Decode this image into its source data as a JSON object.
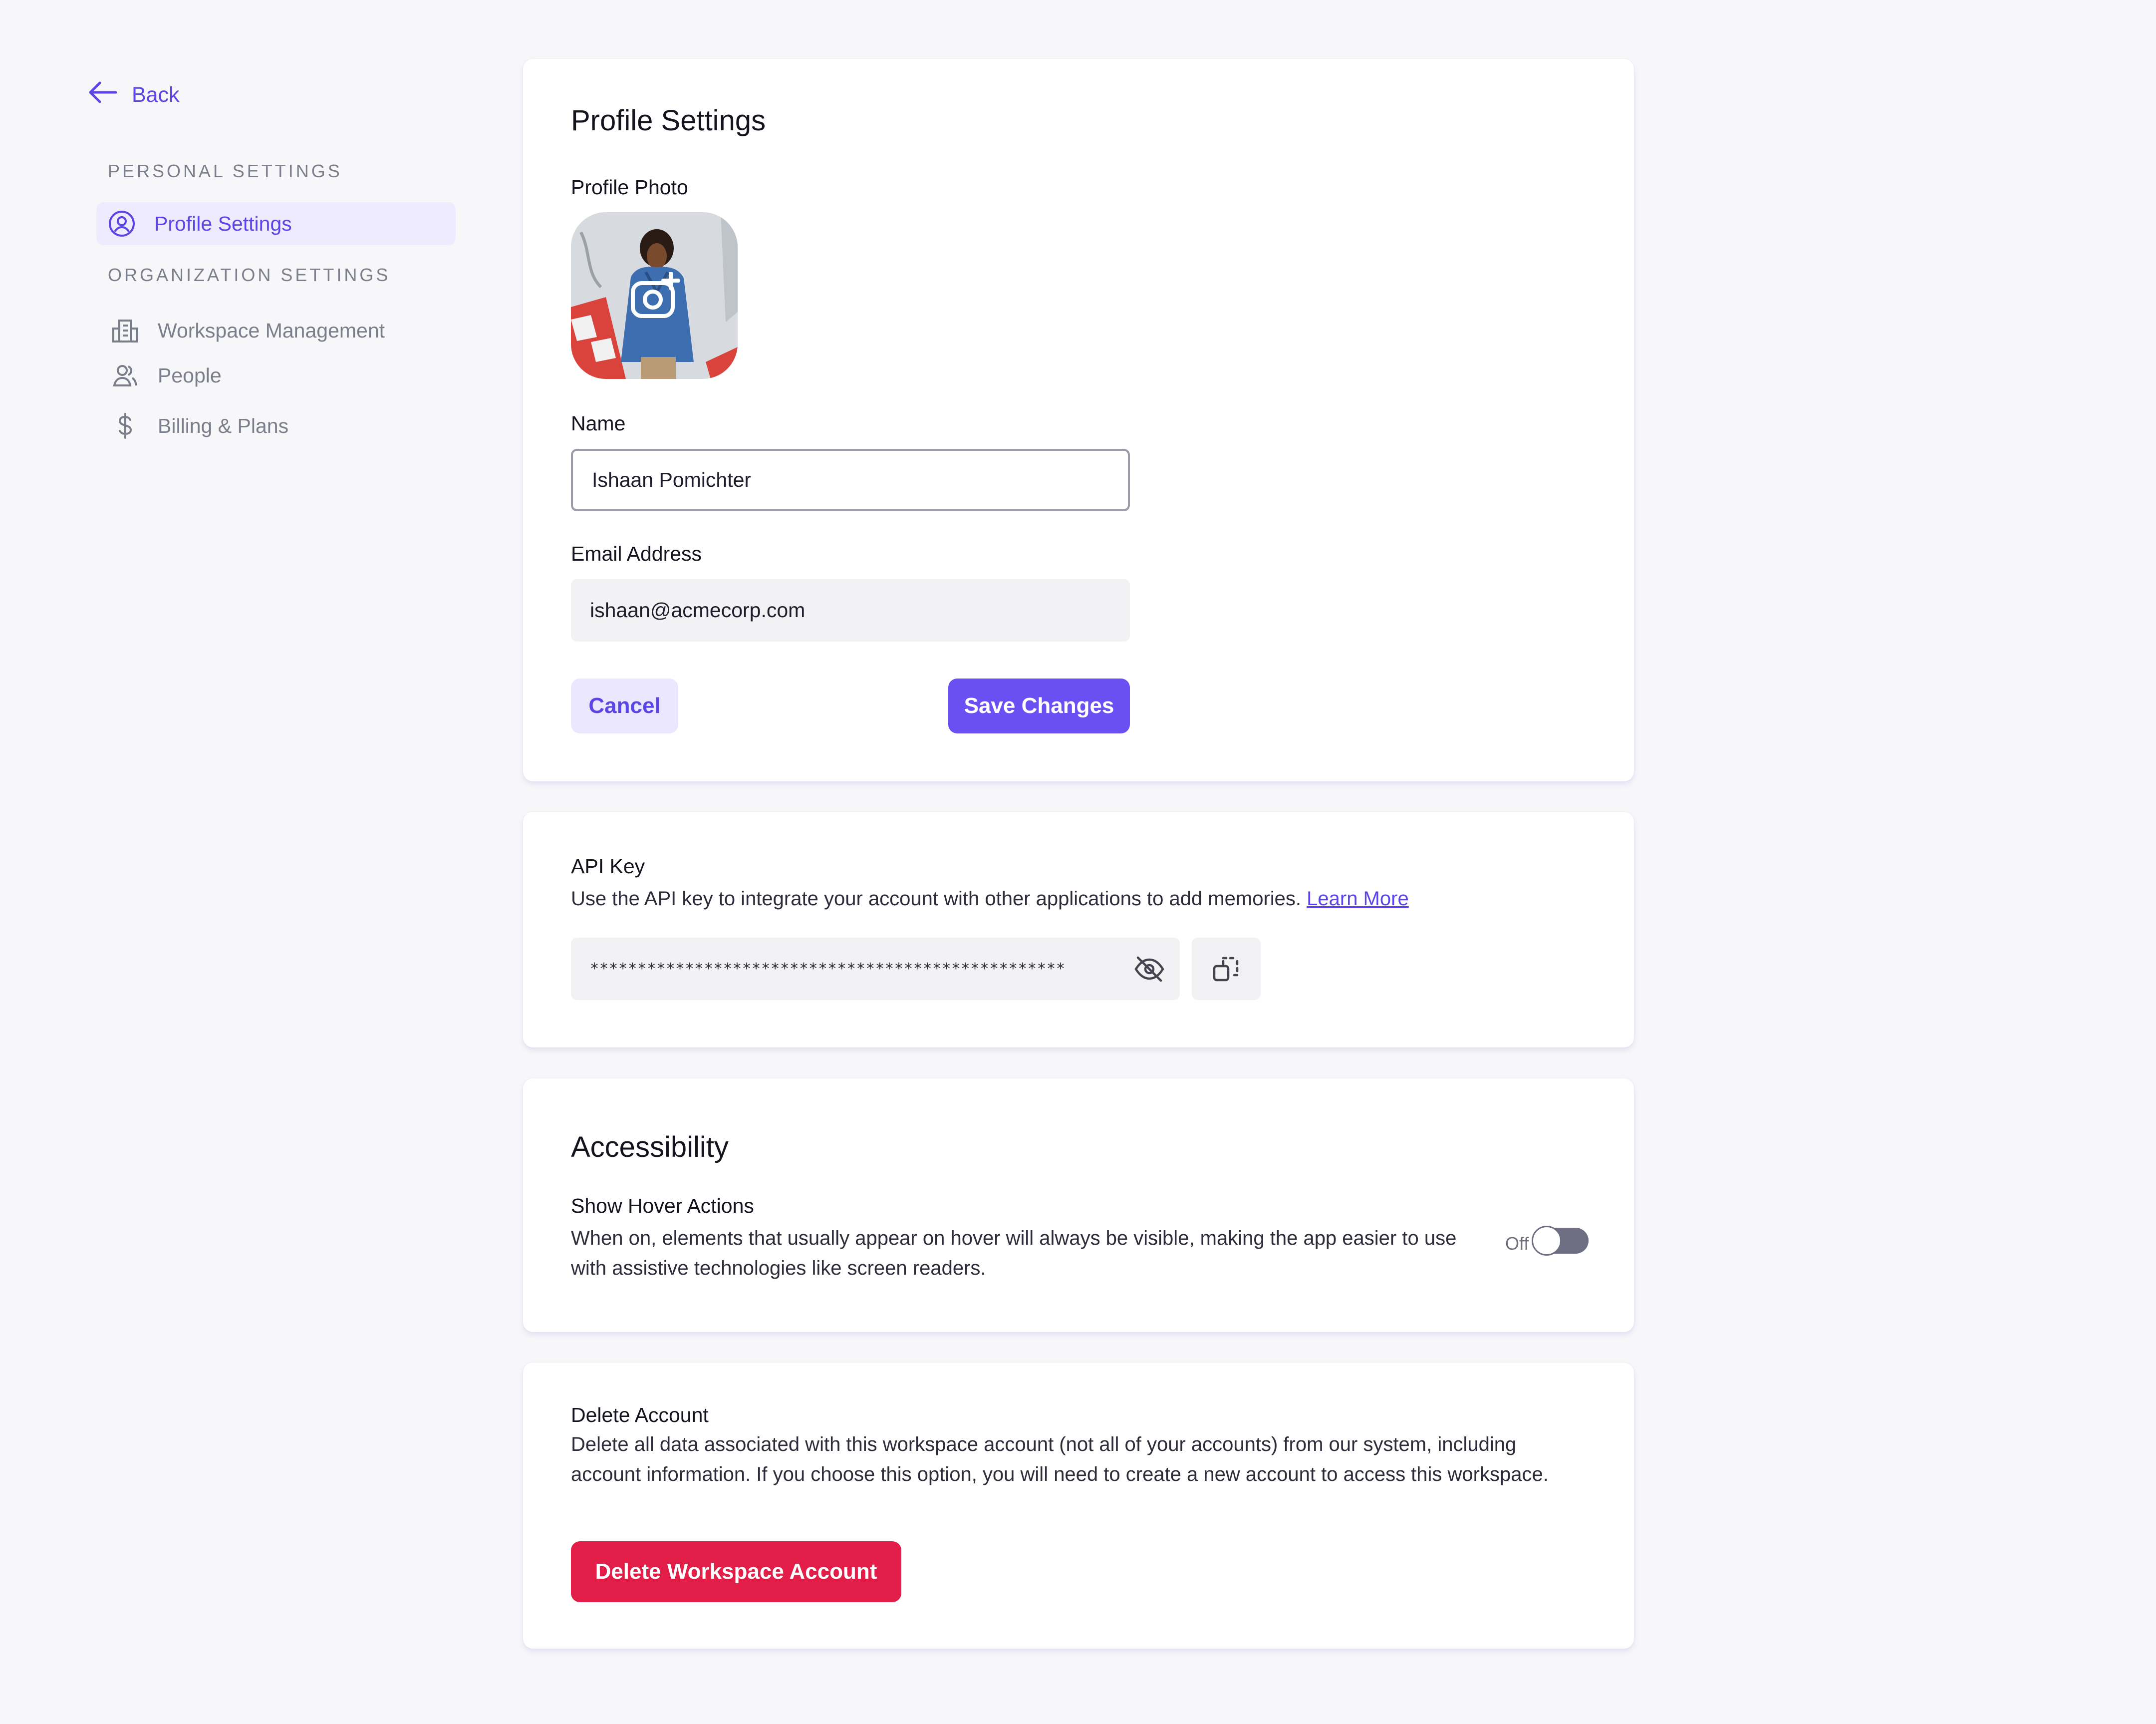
{
  "sidebar": {
    "back_label": "Back",
    "personal_section": "Personal Settings",
    "organization_section": "Organization Settings",
    "items": [
      {
        "label": "Profile Settings",
        "icon": "user-circle-icon",
        "active": true
      },
      {
        "label": "Workspace Management",
        "icon": "building-icon",
        "active": false
      },
      {
        "label": "People",
        "icon": "people-icon",
        "active": false
      },
      {
        "label": "Billing & Plans",
        "icon": "dollar-icon",
        "active": false
      }
    ]
  },
  "profile": {
    "title": "Profile Settings",
    "photo_label": "Profile Photo",
    "photo_icon": "camera-plus-icon",
    "name_label": "Name",
    "name_value": "Ishaan Pomichter",
    "email_label": "Email Address",
    "email_value": "ishaan@acmecorp.com",
    "cancel_label": "Cancel",
    "save_label": "Save Changes"
  },
  "api": {
    "title": "API Key",
    "description": "Use the API key to integrate your account with other applications to add memories.",
    "learn_more": "Learn More",
    "masked_key": "**************************************************",
    "visibility_icon": "eye-off-icon",
    "copy_icon": "copy-icon"
  },
  "accessibility": {
    "title": "Accessibility",
    "option_title": "Show Hover Actions",
    "option_description": "When on, elements that usually appear on hover will always be visible, making the app easier to use with assistive technologies like screen readers.",
    "toggle_state_label": "Off",
    "toggle_on": false
  },
  "delete": {
    "title": "Delete Account",
    "description": "Delete all data associated with this workspace account (not all of your accounts) from our system, including account information. If you choose this option, you will need to create a new account to access this workspace.",
    "button_label": "Delete Workspace Account"
  },
  "colors": {
    "accent": "#5b45e6",
    "primary_button": "#6a4ff2",
    "danger": "#e11d48",
    "background": "#f7f7f9"
  }
}
